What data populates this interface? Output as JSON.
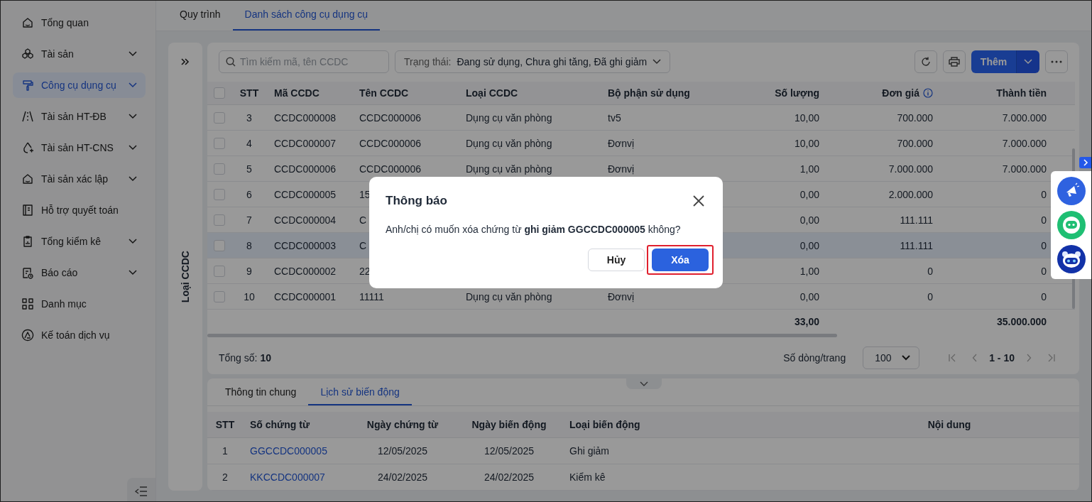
{
  "sidebar": {
    "items": [
      {
        "label": "Tổng quan",
        "expandable": false,
        "selected": false
      },
      {
        "label": "Tài sản",
        "expandable": true,
        "selected": false
      },
      {
        "label": "Công cụ dụng cụ",
        "expandable": true,
        "selected": true
      },
      {
        "label": "Tài sản HT-ĐB",
        "expandable": true,
        "selected": false
      },
      {
        "label": "Tài sản HT-CNS",
        "expandable": true,
        "selected": false
      },
      {
        "label": "Tài sản xác lập",
        "expandable": true,
        "selected": false
      },
      {
        "label": "Hỗ trợ quyết toán",
        "expandable": false,
        "selected": false
      },
      {
        "label": "Tổng kiểm kê",
        "expandable": true,
        "selected": false
      },
      {
        "label": "Báo cáo",
        "expandable": true,
        "selected": false
      },
      {
        "label": "Danh mục",
        "expandable": false,
        "selected": false
      },
      {
        "label": "Kế toán dịch vụ",
        "expandable": false,
        "selected": false
      }
    ]
  },
  "tabs": [
    {
      "label": "Quy trình",
      "selected": false
    },
    {
      "label": "Danh sách công cụ dụng cụ",
      "selected": true
    }
  ],
  "side_panel": {
    "label": "Loại CCDC"
  },
  "toolbar": {
    "search": {
      "placeholder": "Tìm kiếm mã, tên CCDC"
    },
    "status_filter": {
      "label": "Trạng thái:",
      "value": "Đang sử dụng, Chưa ghi tăng, Đã ghi giảm"
    },
    "add_button": "Thêm"
  },
  "table": {
    "columns": [
      "STT",
      "Mã CCDC",
      "Tên CCDC",
      "Loại CCDC",
      "Bộ phận sử dụng",
      "Số lượng",
      "Đơn giá",
      "Thành tiền"
    ],
    "rows": [
      {
        "cells": [
          "3",
          "CCDC000008",
          "CCDC000006",
          "Dụng cụ văn phòng",
          "tv5",
          "10,00",
          "700.000",
          "7.000.000"
        ],
        "checked": false,
        "selected": false
      },
      {
        "cells": [
          "4",
          "CCDC000007",
          "CCDC000006",
          "Dụng cụ văn phòng",
          "Đơnvị",
          "10,00",
          "700.000",
          "7.000.000"
        ],
        "checked": false,
        "selected": false
      },
      {
        "cells": [
          "5",
          "CCDC000006",
          "CCDC000006",
          "Dụng cụ văn phòng",
          "Đơnvị",
          "1,00",
          "7.000.000",
          "7.000.000"
        ],
        "checked": false,
        "selected": false
      },
      {
        "cells": [
          "6",
          "CCDC000005",
          "15",
          null,
          null,
          "0,00",
          "2.000.000",
          "0"
        ],
        "checked": false,
        "selected": false
      },
      {
        "cells": [
          "7",
          "CCDC000004",
          "C",
          null,
          null,
          "0,00",
          "111.111",
          "0"
        ],
        "checked": false,
        "selected": false
      },
      {
        "cells": [
          "8",
          "CCDC000003",
          "C",
          null,
          null,
          "0,00",
          "111.111",
          "0"
        ],
        "checked": false,
        "selected": true
      },
      {
        "cells": [
          "9",
          "CCDC000002",
          "22",
          null,
          null,
          "1,00",
          "0",
          "0"
        ],
        "checked": false,
        "selected": false
      },
      {
        "cells": [
          "10",
          "CCDC000001",
          "11111",
          "Dụng cụ văn phòng",
          "Đơnvị",
          "0,00",
          "0",
          "0"
        ],
        "checked": false,
        "selected": false
      }
    ],
    "select_all_checked": false,
    "totals": {
      "quantity": "33,00",
      "amount": "35.000.000"
    }
  },
  "footer": {
    "total": "Tổng số: **10**",
    "page_size_label": "Số dòng/trang",
    "page_size": "100",
    "range": "1 - 10"
  },
  "detail_tabs": [
    {
      "label": "Thông tin chung",
      "selected": false
    },
    {
      "label": "Lịch sử biến động",
      "selected": true
    }
  ],
  "history": {
    "columns": [
      "STT",
      "Số chứng từ",
      "Ngày chứng từ",
      "Ngày biến động",
      "Loại biến động",
      "Nội dung"
    ],
    "rows": [
      {
        "cells": [
          "1",
          "GGCCDC000005",
          "12/05/2025",
          "12/05/2025",
          "Ghi giảm"
        ]
      },
      {
        "cells": [
          "2",
          "KKCCDC000007",
          "24/02/2025",
          "24/02/2025",
          "Kiểm kê"
        ]
      }
    ]
  },
  "dialog": {
    "title": "Thông báo",
    "message": "Anh/chị có muốn xóa chứng từ **ghi giảm GGCCDC000005** không?",
    "buttons": [
      {
        "label": "Hủy",
        "kind": "secondary",
        "highlighted": false
      },
      {
        "label": "Xóa",
        "kind": "primary",
        "highlighted": true
      }
    ]
  }
}
